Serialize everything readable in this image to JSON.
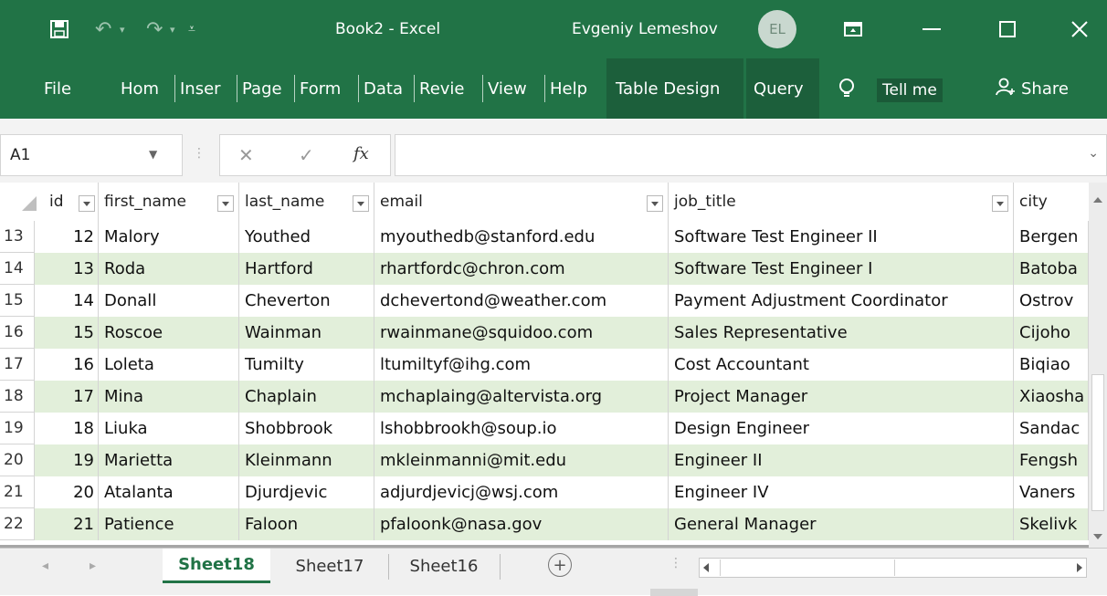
{
  "window": {
    "title": "Book2  -  Excel",
    "user": "Evgeniy Lemeshov",
    "avatar_initials": "EL"
  },
  "ribbon": {
    "tabs": [
      {
        "label": "File"
      },
      {
        "label": "Hom"
      },
      {
        "label": "Inser"
      },
      {
        "label": "Page"
      },
      {
        "label": "Form"
      },
      {
        "label": "Data"
      },
      {
        "label": "Revie"
      },
      {
        "label": "View"
      },
      {
        "label": "Help"
      },
      {
        "label": "Table Design"
      },
      {
        "label": "Query"
      }
    ],
    "tell_me": "Tell me",
    "share": "Share"
  },
  "formula_bar": {
    "name_box": "A1",
    "formula": ""
  },
  "table": {
    "columns": [
      "id",
      "first_name",
      "last_name",
      "email",
      "job_title",
      "city"
    ],
    "rows": [
      {
        "row": "13",
        "id": "12",
        "first_name": "Malory",
        "last_name": "Youthed",
        "email": "myouthedb@stanford.edu",
        "job_title": "Software Test Engineer II",
        "city": "Bergen"
      },
      {
        "row": "14",
        "id": "13",
        "first_name": "Roda",
        "last_name": "Hartford",
        "email": "rhartfordc@chron.com",
        "job_title": "Software Test Engineer I",
        "city": "Batoba"
      },
      {
        "row": "15",
        "id": "14",
        "first_name": "Donall",
        "last_name": "Cheverton",
        "email": "dchevertond@weather.com",
        "job_title": "Payment Adjustment Coordinator",
        "city": "Ostrov"
      },
      {
        "row": "16",
        "id": "15",
        "first_name": "Roscoe",
        "last_name": "Wainman",
        "email": "rwainmane@squidoo.com",
        "job_title": "Sales Representative",
        "city": "Cijoho"
      },
      {
        "row": "17",
        "id": "16",
        "first_name": "Loleta",
        "last_name": "Tumilty",
        "email": "ltumiltyf@ihg.com",
        "job_title": "Cost Accountant",
        "city": "Biqiao"
      },
      {
        "row": "18",
        "id": "17",
        "first_name": "Mina",
        "last_name": "Chaplain",
        "email": "mchaplaing@altervista.org",
        "job_title": "Project Manager",
        "city": "Xiaosha"
      },
      {
        "row": "19",
        "id": "18",
        "first_name": "Liuka",
        "last_name": "Shobbrook",
        "email": "lshobbrookh@soup.io",
        "job_title": "Design Engineer",
        "city": "Sandac"
      },
      {
        "row": "20",
        "id": "19",
        "first_name": "Marietta",
        "last_name": "Kleinmann",
        "email": "mkleinmanni@mit.edu",
        "job_title": "Engineer II",
        "city": "Fengsh"
      },
      {
        "row": "21",
        "id": "20",
        "first_name": "Atalanta",
        "last_name": "Djurdjevic",
        "email": "adjurdjevicj@wsj.com",
        "job_title": "Engineer IV",
        "city": "Vaners"
      },
      {
        "row": "22",
        "id": "21",
        "first_name": "Patience",
        "last_name": "Faloon",
        "email": "pfaloonk@nasa.gov",
        "job_title": "General Manager",
        "city": "Skelivk"
      }
    ]
  },
  "sheets": [
    {
      "label": "Sheet18",
      "active": true
    },
    {
      "label": "Sheet17",
      "active": false
    },
    {
      "label": "Sheet16",
      "active": false
    }
  ],
  "colors": {
    "accent": "#217346",
    "band": "#e2efda"
  }
}
